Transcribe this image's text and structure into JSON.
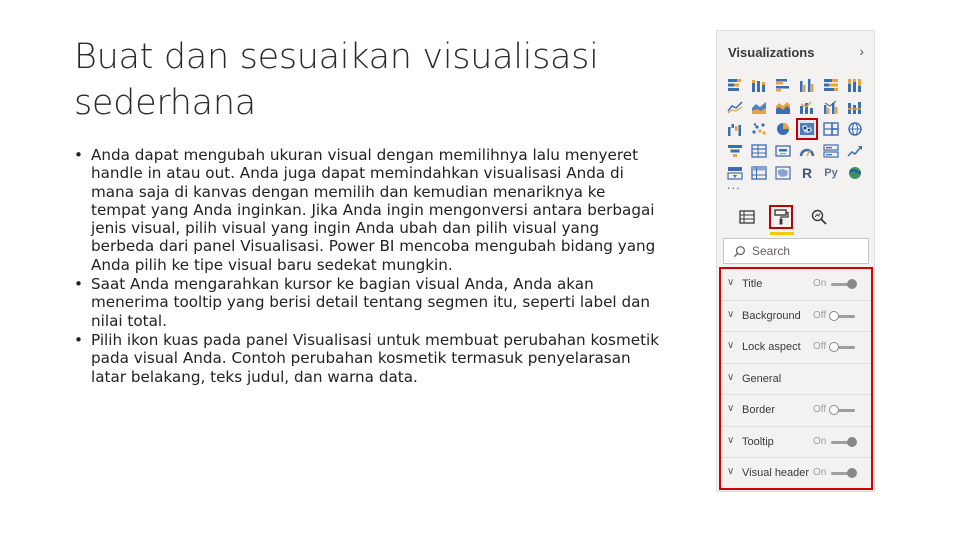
{
  "slide": {
    "title": "Buat dan sesuaikan visualisasi sederhana",
    "bullets": [
      "Anda dapat mengubah ukuran visual dengan memilihnya lalu menyeret handle in atau out. Anda juga dapat memindahkan visualisasi Anda di mana saja di kanvas dengan memilih dan kemudian menariknya ke tempat yang Anda inginkan. Jika Anda ingin mengonversi antara berbagai jenis visual, pilih visual yang ingin Anda ubah dan pilih visual yang berbeda dari panel Visualisasi. Power BI mencoba mengubah bidang yang Anda pilih ke tipe visual baru sedekat mungkin.",
      "Saat Anda mengarahkan kursor ke bagian visual Anda, Anda akan menerima tooltip yang berisi detail tentang segmen itu, seperti label dan nilai total.",
      "Pilih ikon kuas pada panel Visualisasi untuk membuat perubahan kosmetik pada visual Anda. Contoh perubahan kosmetik termasuk penyelarasan latar belakang, teks judul, dan warna data."
    ],
    "bullet_char": "•"
  },
  "pane": {
    "header": "Visualizations",
    "chevron": "›",
    "more": "...",
    "viz_icons": [
      "stacked-bar-icon",
      "stacked-column-icon",
      "clustered-bar-icon",
      "clustered-column-icon",
      "100-stacked-bar-icon",
      "100-stacked-column-icon",
      "line-chart-icon",
      "area-chart-icon",
      "stacked-area-icon",
      "line-column-icon",
      "line-clustered-column-icon",
      "ribbon-chart-icon",
      "waterfall-icon",
      "scatter-icon",
      "pie-chart-icon",
      "map-icon",
      "treemap-icon",
      "globe-map-icon",
      "funnel-icon",
      "table-icon",
      "card-icon",
      "gauge-icon",
      "multirow-card-icon",
      "kpi-icon",
      "slicer-icon",
      "matrix-icon",
      "shape-map-icon",
      "r-visual-icon",
      "python-visual-icon",
      "arcgis-icon"
    ],
    "r_label": "R",
    "py_label": "Py",
    "selected_icon": "map-icon",
    "search_placeholder": "Search",
    "format_items": [
      {
        "label": "Title",
        "state": "On"
      },
      {
        "label": "Background",
        "state": "Off"
      },
      {
        "label": "Lock aspect",
        "state": "Off"
      },
      {
        "label": "General",
        "state": ""
      },
      {
        "label": "Border",
        "state": "Off"
      },
      {
        "label": "Tooltip",
        "state": "On"
      },
      {
        "label": "Visual header",
        "state": "On"
      }
    ],
    "accent_color": "#c00000",
    "tab_underline_color": "#f2c811"
  }
}
